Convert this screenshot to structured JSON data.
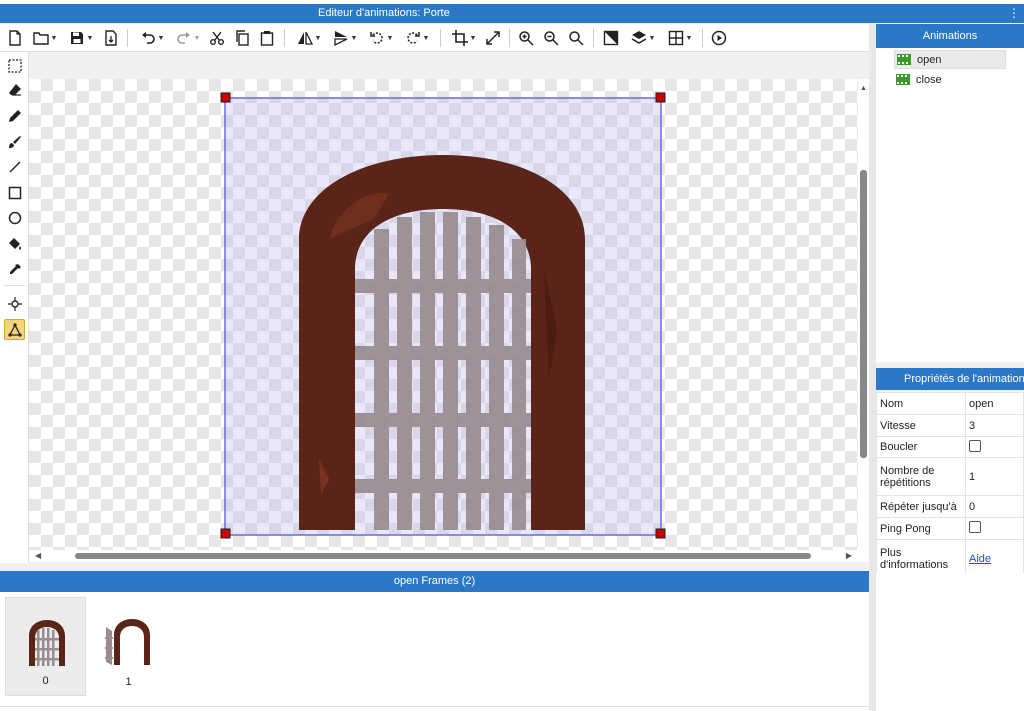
{
  "window": {
    "title": "Editeur d'animations: Porte"
  },
  "canvas": {
    "selected_animation": "open"
  },
  "frames_panel": {
    "title": "open Frames (2)",
    "frames": [
      {
        "label": "0"
      },
      {
        "label": "1"
      }
    ]
  },
  "animations_panel": {
    "title": "Animations",
    "items": [
      {
        "label": "open"
      },
      {
        "label": "close"
      }
    ]
  },
  "properties_panel": {
    "title": "Propriétés de l'animation",
    "rows": {
      "name": {
        "key": "Nom",
        "value": "open"
      },
      "speed": {
        "key": "Vitesse",
        "value": "3"
      },
      "loop": {
        "key": "Boucler",
        "checked": false
      },
      "repetitions": {
        "key": "Nombre de répétitions",
        "value": "1"
      },
      "repeat_until": {
        "key": "Répéter jusqu'à",
        "value": "0"
      },
      "ping_pong": {
        "key": "Ping Pong",
        "checked": false
      },
      "more_info": {
        "key": "Plus d'informations",
        "value": "Aide"
      }
    }
  },
  "colors": {
    "accent": "#2b78c8",
    "door_frame": "#5a2418",
    "door_bars": "#9a8c90",
    "selection": "#6a6ae0",
    "handle": "#cc0000",
    "active_tool": "#f5d37a"
  }
}
